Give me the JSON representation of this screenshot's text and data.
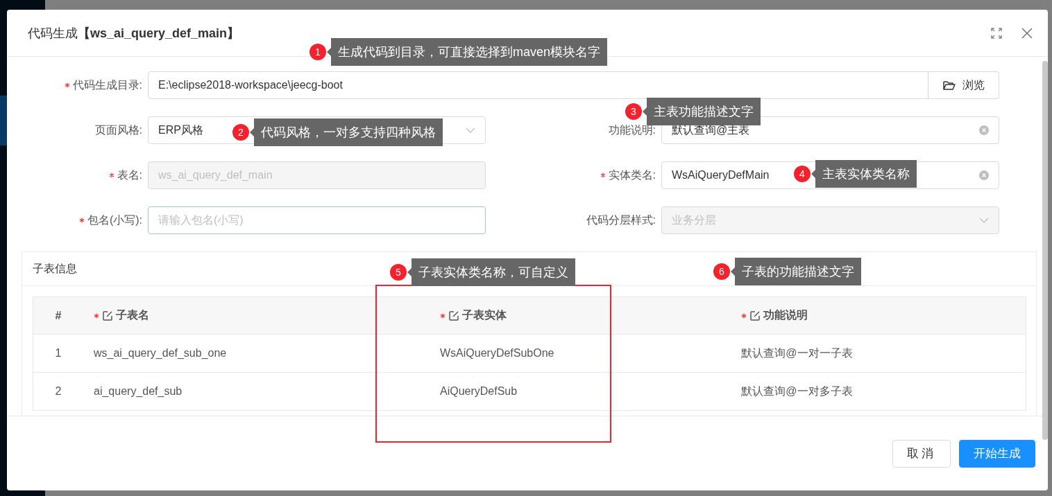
{
  "dialog": {
    "title": "代码生成**【ws_ai_query_def_main】**"
  },
  "fields": [
    {
      "kind": "browse",
      "label": "代码生成目录:",
      "required": true,
      "value": "E:\\eclipse2018-workspace\\jeecg-boot",
      "button": "浏览"
    },
    {
      "kind": "select",
      "label": "页面风格:",
      "required": false,
      "value": "ERP风格",
      "disabled": false
    },
    {
      "kind": "input",
      "label": "功能说明:",
      "required": false,
      "value": "默认查询@主表",
      "clearable": true,
      "disabled": false
    },
    {
      "kind": "input",
      "label": "表名:",
      "required": true,
      "value": "ws_ai_query_def_main",
      "clearable": false,
      "disabled": true
    },
    {
      "kind": "input",
      "label": "实体类名:",
      "required": true,
      "value": "WsAiQueryDefMain",
      "clearable": true,
      "disabled": false
    },
    {
      "kind": "input",
      "label": "包名(小写):",
      "required": true,
      "placeholder": "请输入包名(小写)",
      "clearable": false,
      "disabled": false,
      "focused": true
    },
    {
      "kind": "select",
      "label": "代码分层样式:",
      "required": false,
      "value": "业务分层",
      "disabled": true
    }
  ],
  "subtables": {
    "title": "子表信息",
    "columns": [
      {
        "label": "#",
        "required": false,
        "editable": false
      },
      {
        "label": "子表名",
        "required": true,
        "editable": true
      },
      {
        "label": "子表实体",
        "required": true,
        "editable": true
      },
      {
        "label": "功能说明",
        "required": true,
        "editable": true
      }
    ],
    "rows": [
      [
        "1",
        "ws_ai_query_def_sub_one",
        "WsAiQueryDefSubOne",
        "默认查询@一对一子表"
      ],
      [
        "2",
        "ai_query_def_sub",
        "AiQueryDefSub",
        "默认查询@一对多子表"
      ]
    ]
  },
  "buttons": [
    {
      "label": "取消",
      "primary": false
    },
    {
      "label": "开始生成",
      "primary": true
    }
  ],
  "annotations": [
    {
      "number": "1",
      "text": "生成代码到目录，可直接选择到maven模块名字"
    },
    {
      "number": "2",
      "text": "代码风格，一对多支持四种风格"
    },
    {
      "number": "3",
      "text": "主表功能描述文字"
    },
    {
      "number": "4",
      "text": "主表实体类名称"
    },
    {
      "number": "5",
      "text": "子表实体类名称，可自定义"
    },
    {
      "number": "6",
      "text": "子表的功能描述文字"
    }
  ]
}
